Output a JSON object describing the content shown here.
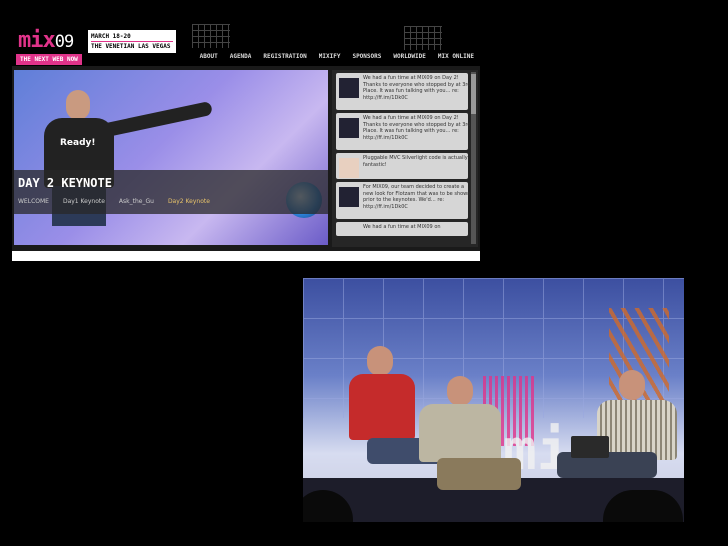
{
  "site": {
    "logo": "mix",
    "logo_year": "09",
    "tagline": "THE NEXT WEB NOW",
    "date_line": "MARCH 18-20",
    "venue_line": "THE VENETIAN LAS VEGAS",
    "nav": [
      "ABOUT",
      "AGENDA",
      "REGISTRATION",
      "MIXIFY",
      "SPONSORS",
      "WORLDWIDE",
      "MIX ONLINE"
    ],
    "hero_shirt": "Ready!",
    "caption_title": "DAY 2 KEYNOTE",
    "caption_links": [
      "WELCOME",
      "Day1 Keynote",
      "Ask_the_Gu",
      "Day2 Keynote"
    ],
    "caption_active_index": 3
  },
  "feed": {
    "tweets": [
      {
        "text": "We had a fun time at MIX09 on Day 2! Thanks to everyone who stopped by at 3rd Place. It was fun talking with you… re:",
        "link": "http://ff.im/1Dk0C"
      },
      {
        "text": "We had a fun time at MIX09 on Day 2! Thanks to everyone who stopped by at 3rd Place. It was fun talking with you… re:",
        "link": "http://ff.im/1Dk0C"
      },
      {
        "text": "Pluggable MVC Silverlight code is actually fantastic!",
        "link": ""
      },
      {
        "text": "For MIX09, our team decided to create a new look for Flotzam that was to be shown prior to the keynotes. We'd… re:",
        "link": "http://ff.im/1Dk0C"
      },
      {
        "text": "We had a fun time at MIX09 on",
        "link": ""
      }
    ]
  },
  "photo2": {
    "sign": "mix"
  },
  "colors": {
    "accent": "#e0338a",
    "background": "#000000"
  }
}
